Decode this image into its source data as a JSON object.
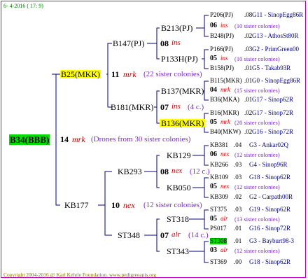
{
  "date_header": "6- 4-2016 ( 17: 9)",
  "footer": "Copyright 2004-2016 @ Karl Kehrle Foundation.   www.pedigreeapis.org",
  "colors": {
    "frame": "#c000c0",
    "link": "#000080",
    "accent": "#cc0000",
    "sc": "#7b28c9",
    "highlight": "#ffff00",
    "root_bg": "#00dd00"
  },
  "root": {
    "name": "B34(BBB)"
  },
  "gen1": {
    "top": {
      "name": "B25(MKK)",
      "num": "11",
      "type": "mrk",
      "note": "(22 sister colonies)"
    },
    "mid": {
      "num": "14",
      "type": "mrk",
      "note": "(Drones from 30 sister colonies)"
    },
    "bottom": {
      "name": "KB177",
      "num": "10",
      "type": "nex",
      "note": "(12 sister colonies)"
    }
  },
  "gen2": {
    "b147": {
      "name": "B147(PJ)",
      "num": "08",
      "type": "ins"
    },
    "b181": {
      "name": "B181(MKR)",
      "num": "07",
      "type": "ins",
      "note": "(4 c.)"
    },
    "kb293": {
      "name": "KB293",
      "num": "08",
      "type": "nex",
      "note": "(12 c.)"
    },
    "st348": {
      "name": "ST348",
      "num": "07",
      "type": "alr",
      "note": "(14 c.)"
    }
  },
  "gen3": {
    "b213": {
      "name": "B213(PJ)"
    },
    "p133h": {
      "name": "P133H(PJ)"
    },
    "b137": {
      "name": "B137(MKR)"
    },
    "b136": {
      "name": "B136(MKR)"
    },
    "kb129": {
      "name": "KB129"
    },
    "kb050": {
      "name": "KB050"
    },
    "st318": {
      "name": "ST318"
    },
    "st343": {
      "name": "ST343"
    }
  },
  "gen4": [
    {
      "name": "P206(PJ)",
      "score": ".08",
      "line": "G11 - SinopEgg86R"
    },
    {
      "num": "06",
      "type": "ins",
      "note": "(10 sister colonies)"
    },
    {
      "name": "B248(PJ)",
      "score": ".02",
      "line": "G13 - AthosSt80R"
    },
    {
      "name": "P166(PJ)",
      "score": ".03",
      "line": "G2 - PrimGreen00"
    },
    {
      "num": "05",
      "type": "ins",
      "note": "(10 sister colonies)"
    },
    {
      "name": "B158(PJ)",
      "score": ".01",
      "line": "G5 - Takab93R"
    },
    {
      "name": "B115(MKR)",
      "score": ".01",
      "line": "G0 - SinopEgg86R"
    },
    {
      "num": "04",
      "type": "mrk",
      "note": "(15 sister colonies)"
    },
    {
      "name": "B36(MKA)",
      "score": ".01",
      "line": "G17 - Sinop62R"
    },
    {
      "name": "B16(MKR)",
      "score": ".02",
      "line": "G17 - Sinop72R"
    },
    {
      "num": "05",
      "type": "mrk",
      "note": "(20 sister colonies)"
    },
    {
      "name": "B40(MKW)",
      "score": ".02",
      "line": "G16 - Sinop72R"
    },
    {
      "name": "KB381",
      "score": ".04",
      "line": "G3 - Ankar02Q"
    },
    {
      "num": "06",
      "type": "nex",
      "note": "(12 sister colonies)"
    },
    {
      "name": "KB266",
      "score": ".03",
      "line": "G4 - Sinop96R"
    },
    {
      "name": "KB109",
      "score": ".03",
      "line": "G18 - Sinop62R"
    },
    {
      "num": "05",
      "type": "nex",
      "note": "(12 sister colonies)"
    },
    {
      "name": "KB309",
      "score": ".02",
      "line": "G2 - Carpath00R"
    },
    {
      "name": "ST375",
      "score": ".03",
      "line": "G19 - Sinop62R"
    },
    {
      "num": "05",
      "type": "alr",
      "note": "(13 sister colonies)"
    },
    {
      "name": "PS017",
      "score": ".01",
      "line": "G16 - Sinop72R"
    },
    {
      "name": "ST308",
      "score": ".01",
      "line": "G3 - Bayburt98-3"
    },
    {
      "num": "03",
      "type": "alr",
      "note": "(12 sister colonies)"
    },
    {
      "name": "ST369",
      "score": ".00",
      "line": "G18 - Sinop62R"
    }
  ]
}
